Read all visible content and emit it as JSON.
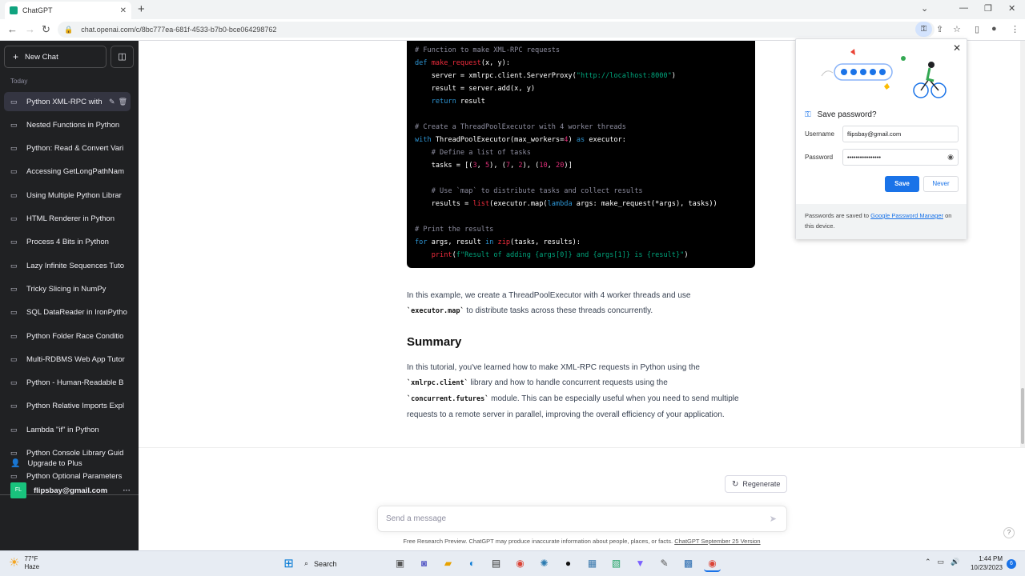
{
  "browser": {
    "tab_title": "ChatGPT",
    "url": "chat.openai.com/c/8bc777ea-681f-4533-b7b0-bce064298762"
  },
  "sidebar": {
    "new_chat": "New Chat",
    "section": "Today",
    "items": [
      {
        "label": "Python XML-RPC with"
      },
      {
        "label": "Nested Functions in Python"
      },
      {
        "label": "Python: Read & Convert Vari"
      },
      {
        "label": "Accessing GetLongPathNam"
      },
      {
        "label": "Using Multiple Python Librar"
      },
      {
        "label": "HTML Renderer in Python"
      },
      {
        "label": "Process 4 Bits in Python"
      },
      {
        "label": "Lazy Infinite Sequences Tuto"
      },
      {
        "label": "Tricky Slicing in NumPy"
      },
      {
        "label": "SQL DataReader in IronPytho"
      },
      {
        "label": "Python Folder Race Conditio"
      },
      {
        "label": "Multi-RDBMS Web App Tutor"
      },
      {
        "label": "Python - Human-Readable B"
      },
      {
        "label": "Python Relative Imports Expl"
      },
      {
        "label": "Lambda \"if\" in Python"
      },
      {
        "label": "Python Console Library Guid"
      },
      {
        "label": "Python Optional Parameters"
      }
    ],
    "upgrade": "Upgrade to Plus",
    "user_initials": "FL",
    "user_email": "flipsbay@gmail.com"
  },
  "code": {
    "lines": [
      "# Function to make XML-RPC requests",
      "def make_request(x, y):",
      "    server = xmlrpc.client.ServerProxy(\"http://localhost:8000\")",
      "    result = server.add(x, y)",
      "    return result",
      "",
      "# Create a ThreadPoolExecutor with 4 worker threads",
      "with ThreadPoolExecutor(max_workers=4) as executor:",
      "    # Define a list of tasks",
      "    tasks = [(3, 5), (7, 2), (10, 20)]",
      "",
      "    # Use `map` to distribute tasks and collect results",
      "    results = list(executor.map(lambda args: make_request(*args), tasks))",
      "",
      "# Print the results",
      "for args, result in zip(tasks, results):",
      "    print(f\"Result of adding {args[0]} and {args[1]} is {result}\")"
    ]
  },
  "content": {
    "p1_a": "In this example, we create a ThreadPoolExecutor with 4 worker threads and use",
    "p1_code": "`executor.map`",
    "p1_b": " to distribute tasks across these threads concurrently.",
    "summary_heading": "Summary",
    "p2_a": "In this tutorial, you've learned how to make XML-RPC requests in Python using the",
    "p2_code1": "`xmlrpc.client`",
    "p2_b": " library and how to handle concurrent requests using the",
    "p2_code2": "`concurrent.futures`",
    "p2_c": " module. This can be especially useful when you need to send multiple requests to a remote server in parallel, improving the overall efficiency of your application."
  },
  "composer": {
    "regenerate": "Regenerate",
    "placeholder": "Send a message",
    "disclaimer": "Free Research Preview. ChatGPT may produce inaccurate information about people, places, or facts.",
    "disclaimer_link": "ChatGPT September 25 Version"
  },
  "password_popup": {
    "title": "Save password?",
    "username_label": "Username",
    "username_value": "flipsbay@gmail.com",
    "password_label": "Password",
    "password_value": "••••••••••••••••",
    "save": "Save",
    "never": "Never",
    "footer_a": "Passwords are saved to ",
    "footer_link": "Google Password Manager",
    "footer_b": " on this device."
  },
  "taskbar": {
    "temp": "77°F",
    "condition": "Haze",
    "search": "Search",
    "time": "1:44 PM",
    "date": "10/23/2023",
    "notifications": "6"
  }
}
